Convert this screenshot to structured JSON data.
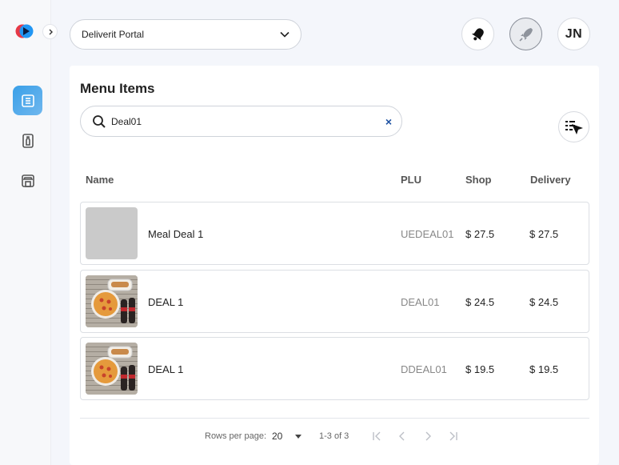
{
  "header": {
    "portal_select": "Deliverit Portal",
    "user_initials": "JN"
  },
  "page": {
    "title": "Menu Items"
  },
  "search": {
    "value": "Deal01",
    "clear_label": "×"
  },
  "table": {
    "columns": [
      "Name",
      "PLU",
      "Shop",
      "Delivery"
    ],
    "rows": [
      {
        "name": "Meal Deal 1",
        "plu": "UEDEAL01",
        "shop": "$ 27.5",
        "delivery": "$ 27.5",
        "image": "placeholder"
      },
      {
        "name": "DEAL 1",
        "plu": "DEAL01",
        "shop": "$ 24.5",
        "delivery": "$ 24.5",
        "image": "pizza-deal-photo"
      },
      {
        "name": "DEAL 1",
        "plu": "DDEAL01",
        "shop": "$ 19.5",
        "delivery": "$ 19.5",
        "image": "pizza-deal-photo"
      }
    ]
  },
  "pagination": {
    "rows_per_page_label": "Rows per page:",
    "rows_per_page_value": "20",
    "range": "1-3 of 3"
  },
  "icons": {
    "logo": "deliverit-logo",
    "expand": "chevron-right-icon",
    "nav": [
      "menu-list-icon",
      "bottle-icon",
      "store-icon"
    ],
    "notifications": "bell-icon",
    "launch": "rocket-icon",
    "search": "search-icon",
    "filter": "filter-list-cursor-icon"
  },
  "colors": {
    "accent": "#3aa0e8",
    "clear_icon": "#1b4fa0",
    "background": "#f4f6fb"
  }
}
